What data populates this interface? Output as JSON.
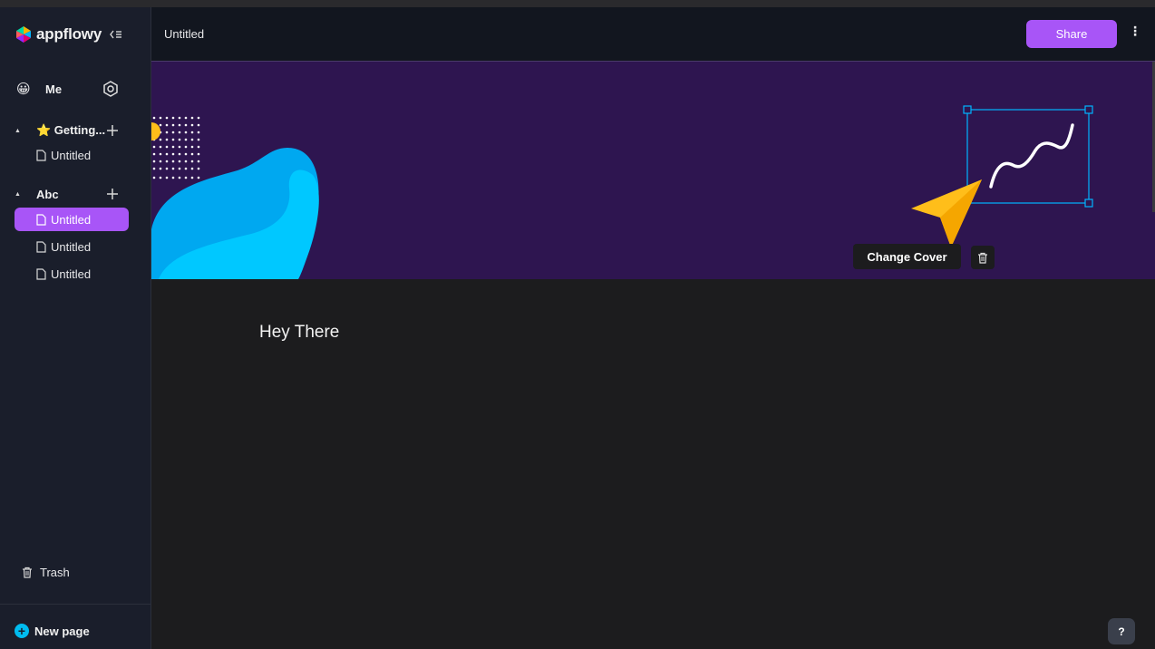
{
  "app": {
    "logo_text": "appflowy"
  },
  "sidebar": {
    "user": {
      "emoji": "😀",
      "name": "Me"
    },
    "sections": [
      {
        "label": "⭐ Getting...",
        "pages": [
          "Untitled"
        ]
      },
      {
        "label": "Abc",
        "pages": [
          "Untitled",
          "Untitled",
          "Untitled"
        ]
      }
    ],
    "trash_label": "Trash",
    "new_page_label": "New page"
  },
  "header": {
    "title": "Untitled",
    "share_label": "Share",
    "more_label": "⋮"
  },
  "cover": {
    "change_cover_label": "Change Cover"
  },
  "document": {
    "heading": "Hey There"
  },
  "help": {
    "label": "?"
  },
  "colors": {
    "accent": "#a855f7",
    "cover_bg": "#2e1550",
    "sidebar_bg": "#1a1e2b"
  }
}
